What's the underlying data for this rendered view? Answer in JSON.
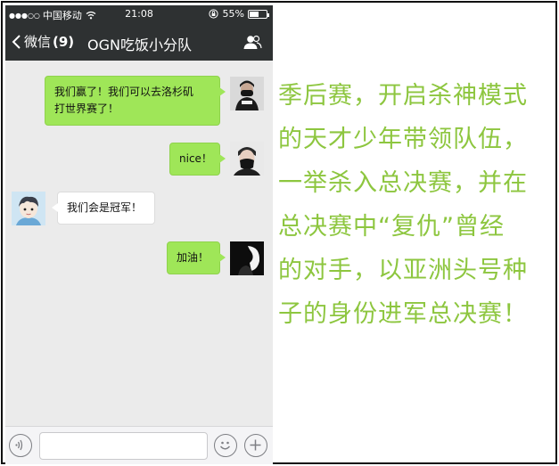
{
  "status_bar": {
    "signal": "●●●○○",
    "carrier": "中国移动",
    "time": "21:08",
    "battery": "55%",
    "battery_level": 0.55
  },
  "nav": {
    "back_label": "微信",
    "back_count": "(9)",
    "title": "OGN吃饭小分队"
  },
  "messages": [
    {
      "side": "mine",
      "lines": [
        "我们赢了！我们可以去洛杉矶",
        "打世界赛了！"
      ],
      "avatar": "masked-player-avatar"
    },
    {
      "side": "mine",
      "lines": [
        "nice！"
      ],
      "avatar": "masked-face-avatar"
    },
    {
      "side": "theirs",
      "lines": [
        "我们会是冠军！"
      ],
      "avatar": "cartoon-boy-avatar"
    },
    {
      "side": "mine",
      "lines": [
        "加油！"
      ],
      "avatar": "dark-silhouette-avatar"
    }
  ],
  "caption": {
    "lines": [
      "季后赛，开启杀神模式",
      "的天才少年带领队伍，",
      "一举杀入总决赛，并在",
      "总决赛中“复仇”曾经",
      "的对手，以亚洲头号种",
      "子的身份进军总决赛！"
    ]
  },
  "colors": {
    "header": "#2e3132",
    "chat_bg": "#ebebeb",
    "bubble_mine": "#9fe658",
    "caption": "#8dc63f"
  }
}
